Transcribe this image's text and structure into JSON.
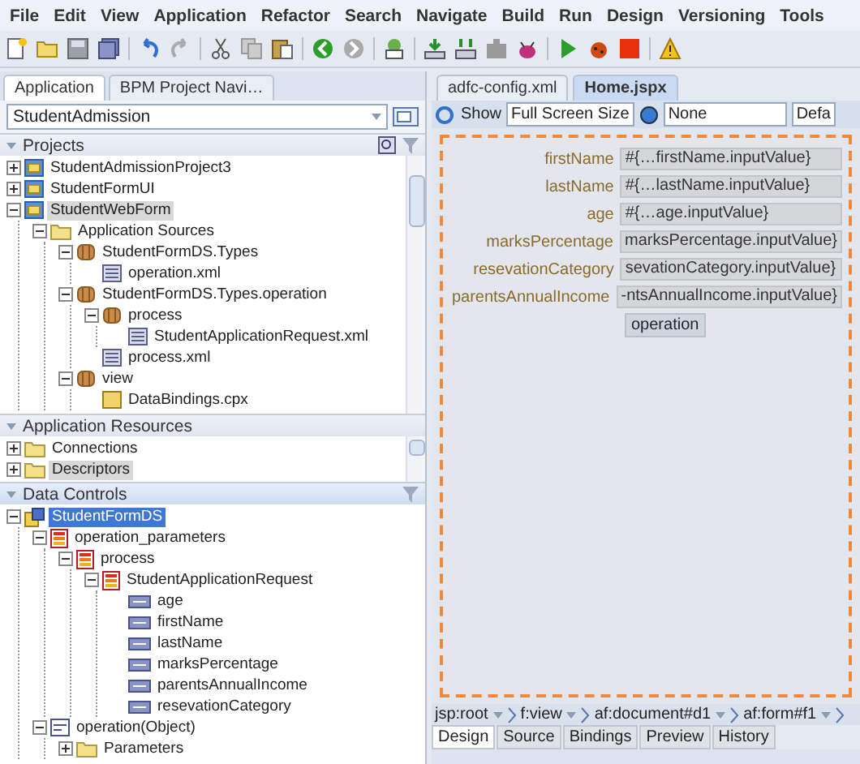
{
  "menu": [
    "File",
    "Edit",
    "View",
    "Application",
    "Refactor",
    "Search",
    "Navigate",
    "Build",
    "Run",
    "Design",
    "Versioning",
    "Tools"
  ],
  "left_panel": {
    "tabs": [
      {
        "label": "Application",
        "selected": true
      },
      {
        "label": "BPM Project Navi…",
        "selected": false
      }
    ],
    "application_selector": {
      "value": "StudentAdmission"
    },
    "projects": {
      "title": "Projects",
      "focused": false,
      "items": [
        {
          "label": "StudentAdmissionProject3",
          "kind": "project",
          "expanded": false,
          "selected": false
        },
        {
          "label": "StudentFormUI",
          "kind": "project",
          "expanded": false,
          "selected": false
        },
        {
          "label": "StudentWebForm",
          "kind": "project",
          "expanded": true,
          "selected": true,
          "children": [
            {
              "label": "Application Sources",
              "kind": "folder",
              "expanded": true,
              "selected": false,
              "children": [
                {
                  "label": "StudentFormDS.Types",
                  "kind": "package",
                  "expanded": true,
                  "selected": false,
                  "children": [
                    {
                      "label": "operation.xml",
                      "kind": "xml",
                      "selected": false
                    }
                  ]
                },
                {
                  "label": "StudentFormDS.Types.operation",
                  "kind": "package",
                  "expanded": true,
                  "selected": false,
                  "children": [
                    {
                      "label": "process",
                      "kind": "package",
                      "expanded": true,
                      "selected": false,
                      "children": [
                        {
                          "label": "StudentApplicationRequest.xml",
                          "kind": "xml",
                          "selected": false
                        }
                      ]
                    },
                    {
                      "label": "process.xml",
                      "kind": "xml",
                      "selected": false
                    }
                  ]
                },
                {
                  "label": "view",
                  "kind": "package",
                  "expanded": true,
                  "selected": false,
                  "children": [
                    {
                      "label": "DataBindings.cpx",
                      "kind": "file",
                      "selected": false
                    }
                  ]
                }
              ]
            }
          ]
        }
      ]
    },
    "application_resources": {
      "title": "Application Resources",
      "focused": false,
      "items": [
        {
          "label": "Connections",
          "kind": "folder",
          "expanded": false,
          "selected": false
        },
        {
          "label": "Descriptors",
          "kind": "folder",
          "expanded": false,
          "selected": true
        }
      ]
    },
    "data_controls": {
      "title": "Data Controls",
      "focused": true,
      "items": [
        {
          "label": "StudentFormDS",
          "kind": "datacontrol",
          "expanded": true,
          "selected": true,
          "children": [
            {
              "label": "operation_parameters",
              "kind": "collection",
              "expanded": true,
              "selected": false,
              "children": [
                {
                  "label": "process",
                  "kind": "collection",
                  "expanded": true,
                  "selected": false,
                  "children": [
                    {
                      "label": "StudentApplicationRequest",
                      "kind": "collection",
                      "expanded": true,
                      "selected": false,
                      "children": [
                        {
                          "label": "age",
                          "kind": "attribute",
                          "selected": false
                        },
                        {
                          "label": "firstName",
                          "kind": "attribute",
                          "selected": false
                        },
                        {
                          "label": "lastName",
                          "kind": "attribute",
                          "selected": false
                        },
                        {
                          "label": "marksPercentage",
                          "kind": "attribute",
                          "selected": false
                        },
                        {
                          "label": "parentsAnnualIncome",
                          "kind": "attribute",
                          "selected": false
                        },
                        {
                          "label": "resevationCategory",
                          "kind": "attribute",
                          "selected": false
                        }
                      ]
                    }
                  ]
                }
              ]
            },
            {
              "label": "operation(Object)",
              "kind": "object",
              "expanded": true,
              "selected": false,
              "children": [
                {
                  "label": "Parameters",
                  "kind": "folder",
                  "expanded": false,
                  "selected": false
                }
              ]
            }
          ]
        }
      ]
    }
  },
  "editor": {
    "tabs": [
      {
        "label": "adfc-config.xml",
        "selected": false
      },
      {
        "label": "Home.jspx",
        "selected": true
      }
    ],
    "toolbar": {
      "show": "Show",
      "screen_size": "Full Screen Size",
      "skin": "None",
      "partial": "Defa"
    },
    "form": {
      "fields": [
        {
          "label": "firstName",
          "value": "#{…firstName.inputValue}"
        },
        {
          "label": "lastName",
          "value": "#{…lastName.inputValue}"
        },
        {
          "label": "age",
          "value": "#{…age.inputValue}"
        },
        {
          "label": "marksPercentage",
          "value": "marksPercentage.inputValue}"
        },
        {
          "label": "resevationCategory",
          "value": "sevationCategory.inputValue}"
        },
        {
          "label": "parentsAnnualIncome",
          "value": "-ntsAnnualIncome.inputValue}"
        }
      ],
      "button": "operation"
    },
    "breadcrumb": [
      "jsp:root",
      "f:view",
      "af:document#d1",
      "af:form#f1"
    ],
    "view_tabs": [
      {
        "label": "Design",
        "selected": true
      },
      {
        "label": "Source",
        "selected": false
      },
      {
        "label": "Bindings",
        "selected": false
      },
      {
        "label": "Preview",
        "selected": false
      },
      {
        "label": "History",
        "selected": false
      }
    ]
  }
}
